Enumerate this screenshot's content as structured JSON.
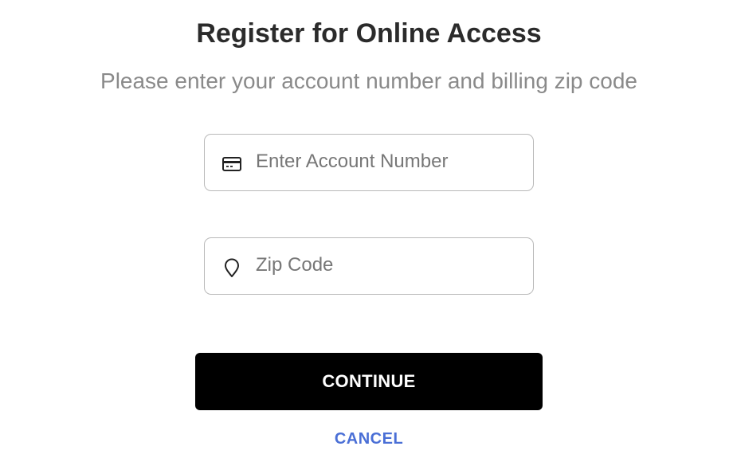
{
  "header": {
    "title": "Register for Online Access",
    "subtitle": "Please enter your account number and billing zip code"
  },
  "form": {
    "account_number": {
      "value": "",
      "placeholder": "Enter Account Number",
      "icon": "credit-card-icon"
    },
    "zip_code": {
      "value": "",
      "placeholder": "Zip Code",
      "icon": "location-pin-icon"
    },
    "continue_label": "CONTINUE",
    "cancel_label": "CANCEL"
  },
  "colors": {
    "title": "#2b2b2b",
    "subtitle": "#8a8a8a",
    "button_bg": "#000000",
    "button_text": "#ffffff",
    "link": "#4a6fd6",
    "field_border": "#b9b9b9"
  }
}
